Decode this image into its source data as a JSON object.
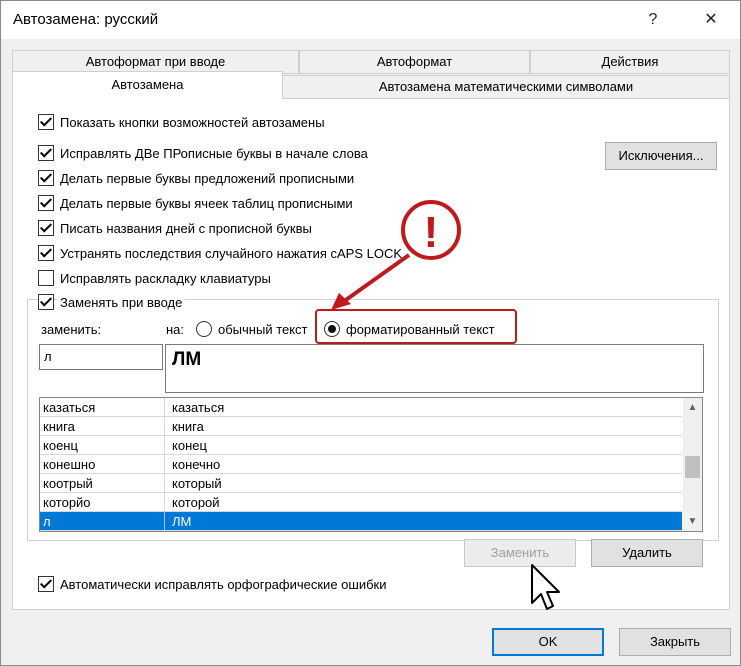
{
  "window": {
    "title": "Автозамена: русский",
    "help_label": "?",
    "close_label": "✕"
  },
  "tabs": {
    "row1": [
      "Автоформат при вводе",
      "Автоформат",
      "Действия"
    ],
    "row2": [
      "Автозамена",
      "Автозамена математическими символами"
    ],
    "active": "Автозамена"
  },
  "options": {
    "show_buttons": "Показать кнопки возможностей автозамены",
    "two_caps": "Исправлять ДВе ПРописные буквы в начале слова",
    "first_sentence": "Делать первые буквы предложений прописными",
    "first_cell": "Делать первые буквы ячеек таблиц прописными",
    "day_names": "Писать названия дней с прописной буквы",
    "caps_lock": "Устранять последствия случайного нажатия cAPS LOCK",
    "keyboard_layout": "Исправлять раскладку клавиатуры",
    "replace_as_type": "Заменять при вводе",
    "auto_spell": "Автоматически исправлять орфографические ошибки"
  },
  "checked": {
    "show_buttons": true,
    "two_caps": true,
    "first_sentence": true,
    "first_cell": true,
    "day_names": true,
    "caps_lock": true,
    "keyboard_layout": false,
    "replace_as_type": true,
    "auto_spell": true
  },
  "exceptions_button": "Исключения...",
  "replace": {
    "replace_label": "заменить:",
    "with_label": "на:",
    "plain_text": "обычный текст",
    "formatted_text": "форматированный текст",
    "selected_format": "formatted",
    "replace_value": "л",
    "with_value": "ЛМ"
  },
  "list_rows": [
    {
      "from": "казаться",
      "to": "казаться"
    },
    {
      "from": "книга",
      "to": "книга"
    },
    {
      "from": "коенц",
      "to": "конец"
    },
    {
      "from": "конешно",
      "to": "конечно"
    },
    {
      "from": "коотрый",
      "to": "который"
    },
    {
      "from": "которйо",
      "to": "которой"
    },
    {
      "from": "л",
      "to": "ЛМ"
    }
  ],
  "selected_row": 6,
  "buttons": {
    "replace": "Заменить",
    "delete": "Удалить",
    "ok": "OK",
    "close": "Закрыть"
  },
  "annotation": {
    "exclamation": "!"
  },
  "colors": {
    "accent": "#0078d7",
    "annotation_red": "#c0191c"
  }
}
